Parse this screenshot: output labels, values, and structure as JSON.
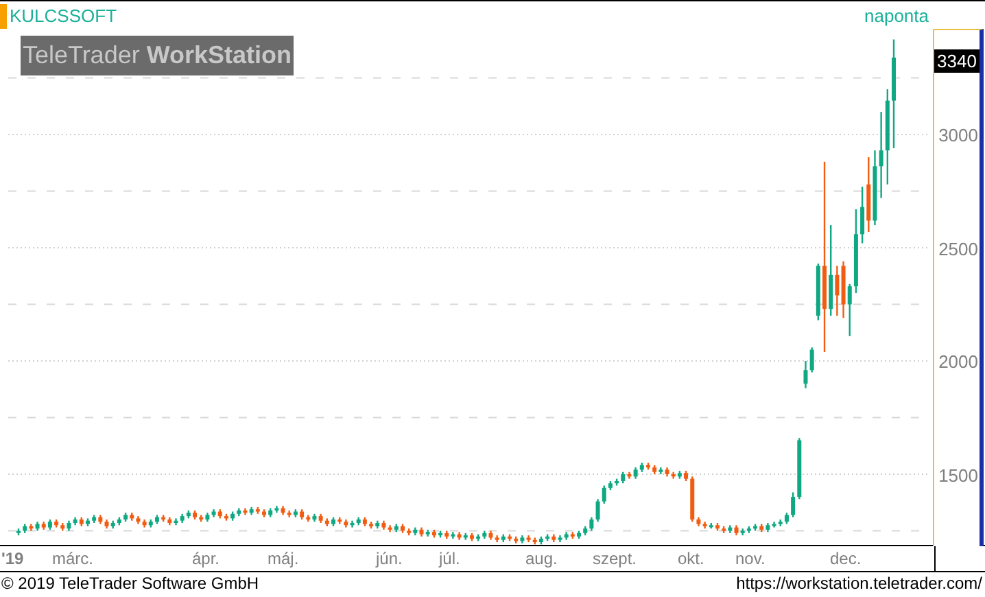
{
  "chart": {
    "symbol": "KULCSSOFT",
    "logo": "TeleTrader **WorkStation**",
    "interval": "naponta",
    "last_price": "3340",
    "year_label": "'19",
    "x_labels": [
      "márc.",
      "ápr.",
      "máj.",
      "jún.",
      "júl.",
      "aug.",
      "szept.",
      "okt.",
      "nov.",
      "dec."
    ],
    "chart_data": {
      "type": "candlestick",
      "grid": true,
      "ylim": [
        1182,
        3467
      ],
      "yticks": [
        1500,
        2000,
        2500,
        3000
      ],
      "ohlc": [
        [
          1240,
          1260,
          1230,
          1250
        ],
        [
          1250,
          1280,
          1240,
          1270
        ],
        [
          1270,
          1280,
          1250,
          1260
        ],
        [
          1260,
          1290,
          1250,
          1280
        ],
        [
          1280,
          1290,
          1255,
          1265
        ],
        [
          1265,
          1300,
          1255,
          1290
        ],
        [
          1290,
          1300,
          1265,
          1275
        ],
        [
          1275,
          1285,
          1250,
          1260
        ],
        [
          1260,
          1295,
          1250,
          1285
        ],
        [
          1285,
          1310,
          1275,
          1300
        ],
        [
          1300,
          1310,
          1270,
          1280
        ],
        [
          1280,
          1305,
          1270,
          1295
        ],
        [
          1295,
          1320,
          1285,
          1310
        ],
        [
          1310,
          1320,
          1280,
          1290
        ],
        [
          1290,
          1300,
          1260,
          1270
        ],
        [
          1270,
          1295,
          1260,
          1285
        ],
        [
          1285,
          1310,
          1275,
          1300
        ],
        [
          1300,
          1330,
          1290,
          1320
        ],
        [
          1320,
          1330,
          1295,
          1305
        ],
        [
          1305,
          1315,
          1280,
          1290
        ],
        [
          1290,
          1300,
          1265,
          1275
        ],
        [
          1275,
          1300,
          1265,
          1290
        ],
        [
          1290,
          1320,
          1280,
          1310
        ],
        [
          1310,
          1320,
          1290,
          1300
        ],
        [
          1300,
          1310,
          1275,
          1285
        ],
        [
          1285,
          1305,
          1275,
          1295
        ],
        [
          1295,
          1325,
          1285,
          1315
        ],
        [
          1315,
          1340,
          1305,
          1330
        ],
        [
          1330,
          1340,
          1300,
          1310
        ],
        [
          1310,
          1320,
          1290,
          1300
        ],
        [
          1300,
          1330,
          1290,
          1320
        ],
        [
          1320,
          1345,
          1310,
          1335
        ],
        [
          1335,
          1345,
          1305,
          1315
        ],
        [
          1315,
          1325,
          1295,
          1305
        ],
        [
          1305,
          1335,
          1295,
          1325
        ],
        [
          1325,
          1350,
          1315,
          1340
        ],
        [
          1340,
          1350,
          1320,
          1330
        ],
        [
          1330,
          1355,
          1320,
          1345
        ],
        [
          1345,
          1355,
          1325,
          1335
        ],
        [
          1335,
          1345,
          1310,
          1320
        ],
        [
          1320,
          1350,
          1310,
          1340
        ],
        [
          1340,
          1360,
          1330,
          1350
        ],
        [
          1350,
          1360,
          1320,
          1330
        ],
        [
          1330,
          1340,
          1310,
          1320
        ],
        [
          1320,
          1345,
          1310,
          1335
        ],
        [
          1335,
          1345,
          1300,
          1310
        ],
        [
          1310,
          1320,
          1290,
          1300
        ],
        [
          1300,
          1325,
          1290,
          1315
        ],
        [
          1315,
          1325,
          1285,
          1295
        ],
        [
          1295,
          1305,
          1270,
          1280
        ],
        [
          1280,
          1310,
          1270,
          1300
        ],
        [
          1300,
          1310,
          1280,
          1290
        ],
        [
          1290,
          1300,
          1265,
          1275
        ],
        [
          1275,
          1295,
          1265,
          1285
        ],
        [
          1285,
          1310,
          1275,
          1300
        ],
        [
          1300,
          1310,
          1270,
          1280
        ],
        [
          1280,
          1290,
          1260,
          1270
        ],
        [
          1270,
          1295,
          1260,
          1285
        ],
        [
          1285,
          1295,
          1255,
          1265
        ],
        [
          1265,
          1275,
          1245,
          1255
        ],
        [
          1255,
          1280,
          1245,
          1270
        ],
        [
          1270,
          1280,
          1240,
          1250
        ],
        [
          1250,
          1260,
          1230,
          1240
        ],
        [
          1240,
          1265,
          1230,
          1255
        ],
        [
          1255,
          1265,
          1225,
          1235
        ],
        [
          1235,
          1255,
          1225,
          1245
        ],
        [
          1245,
          1255,
          1220,
          1230
        ],
        [
          1230,
          1250,
          1220,
          1240
        ],
        [
          1240,
          1250,
          1215,
          1225
        ],
        [
          1225,
          1245,
          1215,
          1235
        ],
        [
          1235,
          1245,
          1210,
          1220
        ],
        [
          1220,
          1240,
          1210,
          1230
        ],
        [
          1230,
          1240,
          1205,
          1215
        ],
        [
          1215,
          1235,
          1205,
          1225
        ],
        [
          1225,
          1250,
          1215,
          1240
        ],
        [
          1240,
          1250,
          1210,
          1220
        ],
        [
          1220,
          1230,
          1200,
          1210
        ],
        [
          1210,
          1235,
          1200,
          1225
        ],
        [
          1225,
          1235,
          1205,
          1215
        ],
        [
          1215,
          1225,
          1195,
          1205
        ],
        [
          1205,
          1230,
          1195,
          1220
        ],
        [
          1220,
          1230,
          1200,
          1210
        ],
        [
          1210,
          1220,
          1190,
          1200
        ],
        [
          1200,
          1225,
          1190,
          1215
        ],
        [
          1215,
          1235,
          1205,
          1225
        ],
        [
          1225,
          1235,
          1200,
          1210
        ],
        [
          1210,
          1230,
          1200,
          1220
        ],
        [
          1220,
          1245,
          1210,
          1235
        ],
        [
          1235,
          1245,
          1215,
          1225
        ],
        [
          1225,
          1250,
          1215,
          1240
        ],
        [
          1240,
          1270,
          1230,
          1260
        ],
        [
          1260,
          1310,
          1250,
          1300
        ],
        [
          1300,
          1390,
          1290,
          1380
        ],
        [
          1380,
          1450,
          1370,
          1440
        ],
        [
          1440,
          1470,
          1430,
          1460
        ],
        [
          1460,
          1480,
          1450,
          1470
        ],
        [
          1470,
          1510,
          1460,
          1500
        ],
        [
          1500,
          1510,
          1480,
          1490
        ],
        [
          1490,
          1530,
          1480,
          1520
        ],
        [
          1520,
          1550,
          1510,
          1540
        ],
        [
          1540,
          1550,
          1520,
          1530
        ],
        [
          1530,
          1540,
          1500,
          1510
        ],
        [
          1510,
          1530,
          1500,
          1520
        ],
        [
          1520,
          1530,
          1490,
          1500
        ],
        [
          1500,
          1510,
          1480,
          1490
        ],
        [
          1490,
          1515,
          1480,
          1505
        ],
        [
          1505,
          1515,
          1470,
          1480
        ],
        [
          1480,
          1490,
          1290,
          1300
        ],
        [
          1300,
          1310,
          1270,
          1280
        ],
        [
          1280,
          1290,
          1260,
          1270
        ],
        [
          1270,
          1285,
          1260,
          1275
        ],
        [
          1275,
          1285,
          1250,
          1260
        ],
        [
          1260,
          1270,
          1240,
          1250
        ],
        [
          1250,
          1275,
          1240,
          1265
        ],
        [
          1265,
          1275,
          1230,
          1240
        ],
        [
          1240,
          1260,
          1230,
          1250
        ],
        [
          1250,
          1270,
          1240,
          1260
        ],
        [
          1260,
          1280,
          1250,
          1270
        ],
        [
          1270,
          1280,
          1245,
          1255
        ],
        [
          1255,
          1285,
          1245,
          1275
        ],
        [
          1275,
          1290,
          1265,
          1280
        ],
        [
          1280,
          1300,
          1270,
          1290
        ],
        [
          1290,
          1330,
          1280,
          1320
        ],
        [
          1320,
          1420,
          1310,
          1400
        ],
        [
          1400,
          1660,
          1390,
          1650
        ],
        [
          1900,
          2000,
          1880,
          1960
        ],
        [
          1960,
          2060,
          1950,
          2050
        ],
        [
          2200,
          2430,
          2180,
          2420
        ],
        [
          2420,
          2880,
          2040,
          2230
        ],
        [
          2230,
          2600,
          2200,
          2380
        ],
        [
          2380,
          2420,
          2200,
          2290
        ],
        [
          2420,
          2440,
          2190,
          2250
        ],
        [
          2250,
          2340,
          2110,
          2330
        ],
        [
          2330,
          2670,
          2300,
          2560
        ],
        [
          2560,
          2770,
          2520,
          2680
        ],
        [
          2780,
          2900,
          2570,
          2620
        ],
        [
          2620,
          2930,
          2600,
          2860
        ],
        [
          2860,
          3100,
          2720,
          2930
        ],
        [
          2930,
          3200,
          2780,
          3150
        ],
        [
          3150,
          3420,
          2940,
          3340
        ]
      ]
    }
  },
  "footer": {
    "copyright": "© 2019 TeleTrader Software GmbH",
    "url": "https://workstation.teletrader.com/"
  }
}
